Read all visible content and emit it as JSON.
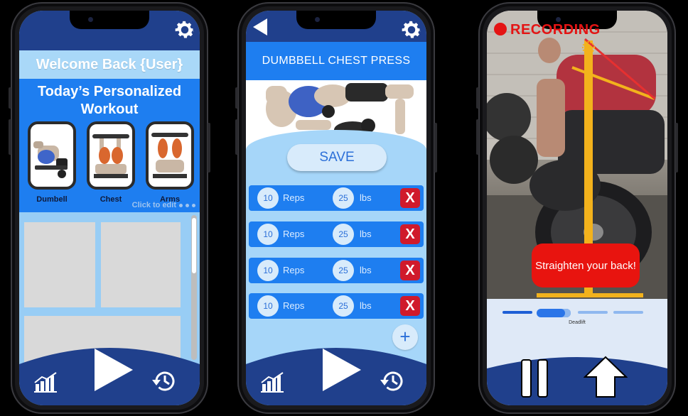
{
  "colors": {
    "navy": "#20408c",
    "blue": "#1e7ef0",
    "light_blue": "#99cdf5",
    "pill": "#d8ebfb",
    "danger": "#d01a2b",
    "recording_red": "#e41414"
  },
  "home": {
    "welcome": "Welcome Back {User}",
    "today_title": "Today’s Personalized Workout",
    "exercises": [
      {
        "label": "Dumbell"
      },
      {
        "label": "Chest"
      },
      {
        "label": "Arms"
      }
    ],
    "click_to_edit": "Click to edit",
    "nav": {
      "stats_icon": "chart-icon",
      "play_icon": "play-icon",
      "history_icon": "history-icon"
    }
  },
  "exercise_detail": {
    "title": "DUMBBELL CHEST PRESS",
    "save_label": "SAVE",
    "sets": [
      {
        "reps": "10",
        "reps_unit": "Reps",
        "weight": "25",
        "weight_unit": "lbs",
        "delete": "X"
      },
      {
        "reps": "10",
        "reps_unit": "Reps",
        "weight": "25",
        "weight_unit": "lbs",
        "delete": "X"
      },
      {
        "reps": "10",
        "reps_unit": "Reps",
        "weight": "25",
        "weight_unit": "lbs",
        "delete": "X"
      },
      {
        "reps": "10",
        "reps_unit": "Reps",
        "weight": "25",
        "weight_unit": "lbs",
        "delete": "X"
      }
    ],
    "add_label": "+"
  },
  "recording": {
    "status": "RECORDING",
    "alert": "Straighten your back!",
    "progress_label": "Deadlift"
  }
}
